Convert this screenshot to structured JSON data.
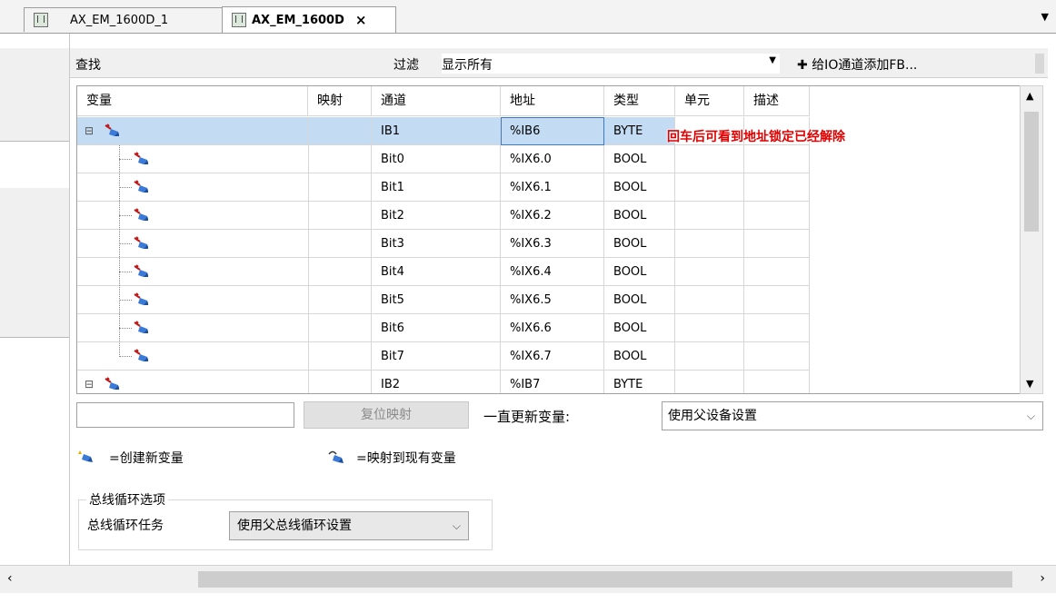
{
  "tabs": [
    {
      "label": "AX_EM_1600D_1",
      "active": false
    },
    {
      "label": "AX_EM_1600D",
      "active": true,
      "close": "×"
    }
  ],
  "toolbar": {
    "search_label": "查找",
    "filter_label": "过滤",
    "filter_value": "显示所有",
    "add_fb_label": "给IO通道添加FB..."
  },
  "table": {
    "headers": [
      "变量",
      "映射",
      "通道",
      "地址",
      "类型",
      "单元",
      "描述"
    ],
    "rows": [
      {
        "channel": "IB1",
        "address": "%IB6",
        "type": "BYTE",
        "level": 0
      },
      {
        "channel": "Bit0",
        "address": "%IX6.0",
        "type": "BOOL",
        "level": 1
      },
      {
        "channel": "Bit1",
        "address": "%IX6.1",
        "type": "BOOL",
        "level": 1
      },
      {
        "channel": "Bit2",
        "address": "%IX6.2",
        "type": "BOOL",
        "level": 1
      },
      {
        "channel": "Bit3",
        "address": "%IX6.3",
        "type": "BOOL",
        "level": 1
      },
      {
        "channel": "Bit4",
        "address": "%IX6.4",
        "type": "BOOL",
        "level": 1
      },
      {
        "channel": "Bit5",
        "address": "%IX6.5",
        "type": "BOOL",
        "level": 1
      },
      {
        "channel": "Bit6",
        "address": "%IX6.6",
        "type": "BOOL",
        "level": 1
      },
      {
        "channel": "Bit7",
        "address": "%IX6.7",
        "type": "BOOL",
        "level": 1
      },
      {
        "channel": "IB2",
        "address": "%IB7",
        "type": "BYTE",
        "level": 0
      }
    ]
  },
  "annotation": "回车后可看到地址锁定已经解除",
  "bottom": {
    "reset_mapping": "复位映射",
    "always_update_label": "一直更新变量:",
    "always_update_value": "使用父设备设置",
    "legend_new": "=创建新变量",
    "legend_existing": "=映射到现有变量",
    "bus_group_title": "总线循环选项",
    "bus_task_label": "总线循环任务",
    "bus_task_value": "使用父总线循环设置"
  },
  "colors": {
    "selection": "#c3dcf4",
    "annotation": "#e00000"
  }
}
